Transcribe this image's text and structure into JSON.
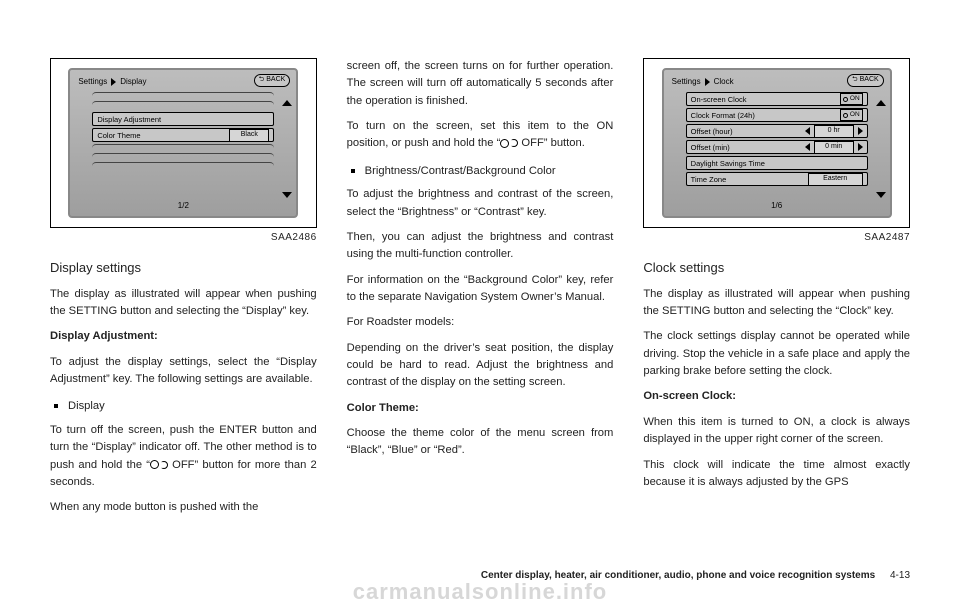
{
  "fig1": {
    "caption": "SAA2486",
    "breadcrumb1": "Settings",
    "breadcrumb2": "Display",
    "back": "BACK",
    "row1": "Display Adjustment",
    "row2_label": "Color Theme",
    "row2_value": "Black",
    "page_indicator": "1/2"
  },
  "fig2": {
    "caption": "SAA2487",
    "breadcrumb1": "Settings",
    "breadcrumb2": "Clock",
    "back": "BACK",
    "r1": "On-screen Clock",
    "r1v": "ON",
    "r2": "Clock Format (24h)",
    "r2v": "ON",
    "r3": "Offset (hour)",
    "r3v": "0 hr",
    "r4": "Offset (min)",
    "r4v": "0 min",
    "r5": "Daylight Savings Time",
    "r6": "Time Zone",
    "r6v": "Eastern",
    "page_indicator": "1/6"
  },
  "col1": {
    "h1": "Display settings",
    "p1": "The display as illustrated will appear when pushing the SETTING button and selecting the “Display” key.",
    "b1": "Display Adjustment:",
    "p2": "To adjust the display settings, select the “Display Adjustment” key. The following settings are available.",
    "li1": "Display",
    "p3": "To turn off the screen, push the ENTER button and turn the “Display” indicator off. The other method is to push and hold the “",
    "p3b": " OFF” button for more than 2 seconds.",
    "p4": "When any mode button is pushed with the"
  },
  "col2": {
    "p1": "screen off, the screen turns on for further operation. The screen will turn off automatically 5 seconds after the operation is finished.",
    "p2a": "To turn on the screen, set this item to the ON position, or push and hold the “",
    "p2b": " OFF” button.",
    "li1": "Brightness/Contrast/Background Color",
    "p3": "To adjust the brightness and contrast of the screen, select the “Brightness” or “Contrast” key.",
    "p4": "Then, you can adjust the brightness and contrast using the multi-function controller.",
    "p5": "For information on the “Background Color” key, refer to the separate Navigation System Owner’s Manual.",
    "p6": "For Roadster models:",
    "p7": "Depending on the driver’s seat position, the display could be hard to read. Adjust the brightness and contrast of the display on the setting screen.",
    "b1": "Color Theme:",
    "p8": "Choose the theme color of the menu screen from “Black”, “Blue” or “Red”."
  },
  "col3": {
    "h1": "Clock settings",
    "p1": "The display as illustrated will appear when pushing the SETTING button and selecting the “Clock” key.",
    "p2": "The clock settings display cannot be operated while driving. Stop the vehicle in a safe place and apply the parking brake before setting the clock.",
    "b1": "On-screen Clock:",
    "p3": "When this item is turned to ON, a clock is always displayed in the upper right corner of the screen.",
    "p4": "This clock will indicate the time almost exactly because it is always adjusted by the GPS"
  },
  "footer": {
    "section": "Center display, heater, air conditioner, audio, phone and voice recognition systems",
    "page": "4-13"
  },
  "watermark": "carmanualsonline.info"
}
